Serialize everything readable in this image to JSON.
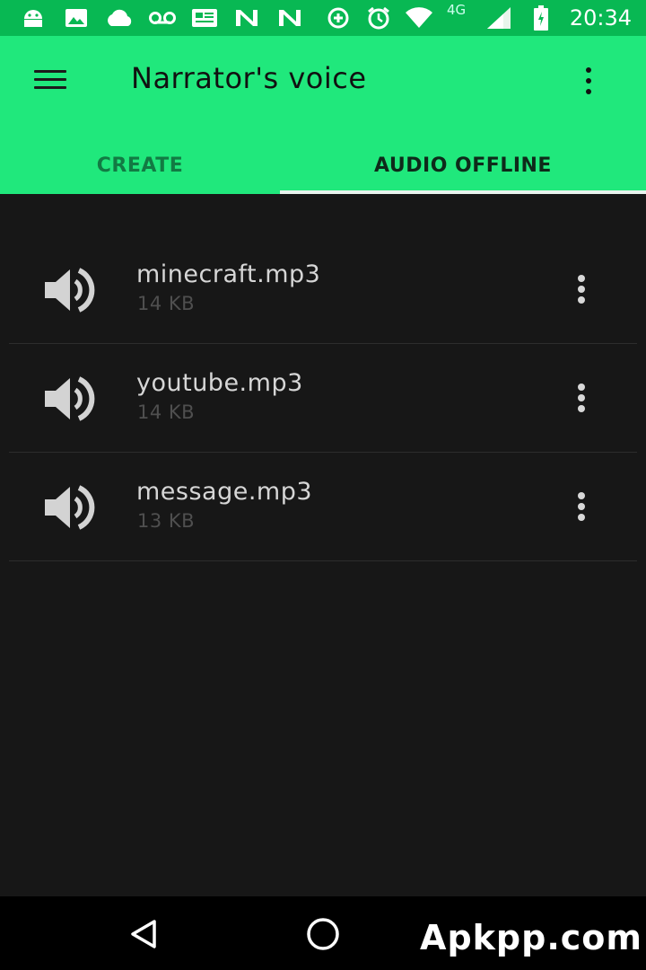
{
  "status_bar": {
    "time": "20:34",
    "network": "4G",
    "icons": [
      "android-mascot-icon",
      "image-icon",
      "cloud-icon",
      "voicemail-icon",
      "news-icon",
      "n-app-icon",
      "n-app-icon",
      "data-saver-icon",
      "alarm-icon",
      "wifi-icon",
      "signal-icon",
      "battery-icon"
    ]
  },
  "app_bar": {
    "title": "Narrator's voice",
    "menu_icon": "hamburger-menu-icon",
    "overflow_icon": "more-vert-icon",
    "background": "#20e87c"
  },
  "tabs": [
    {
      "label": "CREATE",
      "selected": false
    },
    {
      "label": "AUDIO OFFLINE",
      "selected": true
    }
  ],
  "files": [
    {
      "name": "minecraft.mp3",
      "size": "14 KB",
      "icon": "speaker-icon"
    },
    {
      "name": "youtube.mp3",
      "size": "14 KB",
      "icon": "speaker-icon"
    },
    {
      "name": "message.mp3",
      "size": "13 KB",
      "icon": "speaker-icon"
    }
  ],
  "nav_bar": {
    "icons": [
      "back-icon",
      "home-icon"
    ]
  },
  "watermark": "Apkpp.com"
}
